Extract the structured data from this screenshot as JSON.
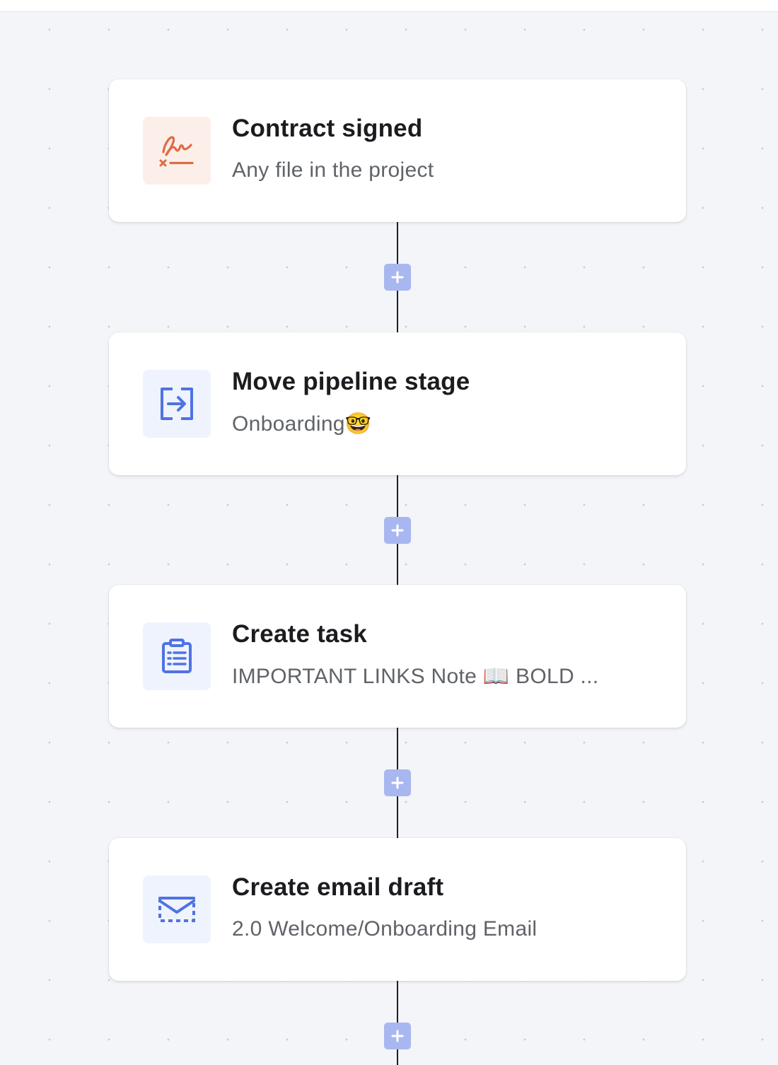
{
  "workflow": {
    "steps": [
      {
        "title": "Contract signed",
        "subtitle": "Any file in the project",
        "icon": "signature-icon",
        "icon_color": "#e06a45",
        "tile_color": "#fcefe9"
      },
      {
        "title": "Move pipeline stage",
        "subtitle": "Onboarding🤓",
        "icon": "move-stage-icon",
        "icon_color": "#4f73e3",
        "tile_color": "#eff3fd"
      },
      {
        "title": "Create task",
        "subtitle": "IMPORTANT LINKS Note 📖 BOLD ...",
        "icon": "clipboard-list-icon",
        "icon_color": "#4f73e3",
        "tile_color": "#eff3fd"
      },
      {
        "title": "Create email draft",
        "subtitle": "2.0 Welcome/Onboarding Email",
        "icon": "email-draft-icon",
        "icon_color": "#4f73e3",
        "tile_color": "#eff3fd"
      }
    ],
    "add_step_icon": "plus-icon",
    "add_button_color": "#a9b7f0"
  }
}
